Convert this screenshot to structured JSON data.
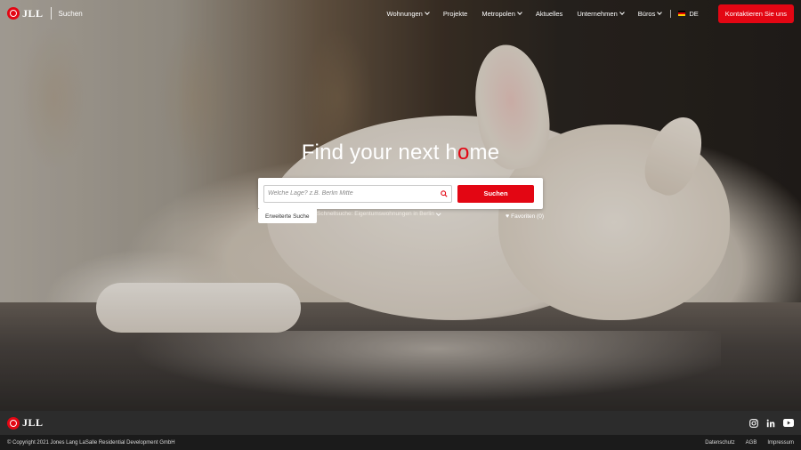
{
  "header": {
    "logo_text": "JLL",
    "search_label": "Suchen",
    "nav": [
      {
        "label": "Wohnungen",
        "has_dropdown": true
      },
      {
        "label": "Projekte",
        "has_dropdown": false
      },
      {
        "label": "Metropolen",
        "has_dropdown": true
      },
      {
        "label": "Aktuelles",
        "has_dropdown": false
      },
      {
        "label": "Unternehmen",
        "has_dropdown": true
      },
      {
        "label": "Büros",
        "has_dropdown": true
      }
    ],
    "language": "DE",
    "contact_button": "Kontaktieren Sie uns"
  },
  "hero": {
    "title_part1": "Find your next h",
    "title_accent": "o",
    "title_part2": "me",
    "search_placeholder": "Welche Lage? z.B. Berlin Mitte",
    "search_button": "Suchen",
    "advanced_search": "Erweiterte Suche",
    "quick_link": "Schnellsuche: Eigentumswohnungen in Berlin",
    "favorites": "Favoriten (0)"
  },
  "footer": {
    "logo_text": "JLL",
    "copyright": "© Copyright 2021 Jones Lang LaSalle Residential Development GmbH",
    "links": [
      "Datenschutz",
      "AGB",
      "Impressum"
    ],
    "social_icons": [
      "instagram-icon",
      "linkedin-icon",
      "youtube-icon"
    ]
  },
  "colors": {
    "brand_red": "#e30613",
    "footer_dark": "#2c2c2c",
    "footer_darker": "#1b1b1b"
  }
}
